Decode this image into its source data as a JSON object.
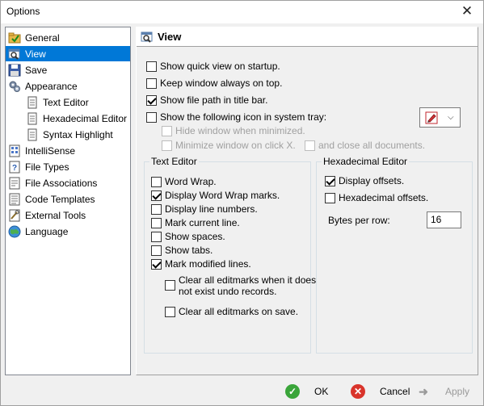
{
  "window": {
    "title": "Options",
    "close_symbol": "✕"
  },
  "sidebar": {
    "items": [
      {
        "label": "General",
        "icon": "folder-check-icon"
      },
      {
        "label": "View",
        "icon": "magnifier-window-icon"
      },
      {
        "label": "Save",
        "icon": "floppy-disk-icon"
      },
      {
        "label": "Appearance",
        "icon": "gears-icon"
      },
      {
        "label": "Text Editor",
        "icon": "page-icon"
      },
      {
        "label": "Hexadecimal Editor",
        "icon": "page-icon"
      },
      {
        "label": "Syntax Highlight",
        "icon": "page-icon"
      },
      {
        "label": "IntelliSense",
        "icon": "grid-page-icon"
      },
      {
        "label": "File Types",
        "icon": "question-page-icon"
      },
      {
        "label": "File Associations",
        "icon": "page-link-icon"
      },
      {
        "label": "Code Templates",
        "icon": "page-code-icon"
      },
      {
        "label": "External Tools",
        "icon": "tools-icon"
      },
      {
        "label": "Language",
        "icon": "globe-icon"
      }
    ],
    "selected": "View"
  },
  "panel": {
    "title": "View",
    "general_options": [
      {
        "label": "Show quick view on startup.",
        "checked": false,
        "enabled": true
      },
      {
        "label": "Keep window always on top.",
        "checked": false,
        "enabled": true
      },
      {
        "label": "Show file path in title bar.",
        "checked": true,
        "enabled": true
      },
      {
        "label": "Show the following icon in system tray:",
        "checked": false,
        "enabled": true
      },
      {
        "label": "Hide window when minimized.",
        "checked": false,
        "enabled": false
      },
      {
        "label": "Minimize window on click X.",
        "checked": false,
        "enabled": false
      },
      {
        "label": "and close all documents.",
        "checked": false,
        "enabled": false
      }
    ],
    "tray_icon": {
      "icon": "pencil-red-icon",
      "arrow": "⌵"
    },
    "text_editor": {
      "legend": "Text Editor",
      "options": [
        {
          "label": "Word Wrap.",
          "checked": false
        },
        {
          "label": "Display Word Wrap marks.",
          "checked": true
        },
        {
          "label": "Display line numbers.",
          "checked": false
        },
        {
          "label": "Mark current line.",
          "checked": false
        },
        {
          "label": "Show spaces.",
          "checked": false
        },
        {
          "label": "Show tabs.",
          "checked": false
        },
        {
          "label": "Mark modified lines.",
          "checked": true
        }
      ],
      "sub_options": [
        {
          "line1": "Clear all editmarks when it does",
          "line2": "not exist undo records.",
          "checked": false
        },
        {
          "line1": "Clear all editmarks on save.",
          "line2": "",
          "checked": false
        }
      ]
    },
    "hex_editor": {
      "legend": "Hexadecimal Editor",
      "options": [
        {
          "label": "Display offsets.",
          "checked": true
        },
        {
          "label": "Hexadecimal offsets.",
          "checked": false
        }
      ],
      "bytes_per_row_label": "Bytes per row:",
      "bytes_per_row_value": "16"
    }
  },
  "footer": {
    "ok_label": "OK",
    "cancel_label": "Cancel",
    "apply_label": "Apply"
  },
  "colors": {
    "selection": "#0078d7",
    "ok_icon": "#3aa53a",
    "cancel_icon": "#d9342b",
    "apply_icon": "#9a9a9a"
  }
}
